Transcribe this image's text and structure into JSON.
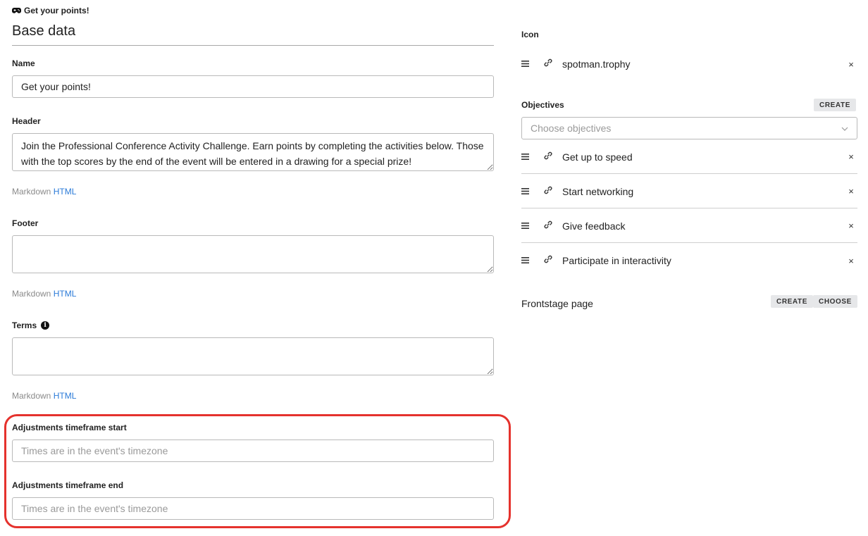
{
  "breadcrumb": {
    "title": "Get your points!",
    "icon": "gamepad-icon"
  },
  "section_title": "Base data",
  "form": {
    "name": {
      "label": "Name",
      "value": "Get your points!"
    },
    "header": {
      "label": "Header",
      "value": "Join the Professional Conference Activity Challenge. Earn points by completing the activities below. Those with the top scores by the end of the event will be entered in a drawing for a special prize!",
      "hint_prefix": "Markdown",
      "hint_link": "HTML"
    },
    "footer": {
      "label": "Footer",
      "value": "",
      "hint_prefix": "Markdown",
      "hint_link": "HTML"
    },
    "terms": {
      "label": "Terms",
      "value": "",
      "hint_prefix": "Markdown",
      "hint_link": "HTML",
      "info_icon": "info-icon"
    },
    "adj_start": {
      "label": "Adjustments timeframe start",
      "placeholder": "Times are in the event's timezone"
    },
    "adj_end": {
      "label": "Adjustments timeframe end",
      "placeholder": "Times are in the event's timezone"
    }
  },
  "right": {
    "icon_label": "Icon",
    "icon_value": "spotman.trophy",
    "objectives_label": "Objectives",
    "create_label": "CREATE",
    "choose_label": "CHOOSE",
    "objectives_placeholder": "Choose objectives",
    "objectives": [
      {
        "label": "Get up to speed"
      },
      {
        "label": "Start networking"
      },
      {
        "label": "Give feedback"
      },
      {
        "label": "Participate in interactivity"
      }
    ],
    "frontstage_label": "Frontstage page",
    "close_glyph": "×"
  },
  "colors": {
    "link": "#2b7bd8",
    "highlight": "#e5322d",
    "button_bg": "#e6e7e9"
  }
}
